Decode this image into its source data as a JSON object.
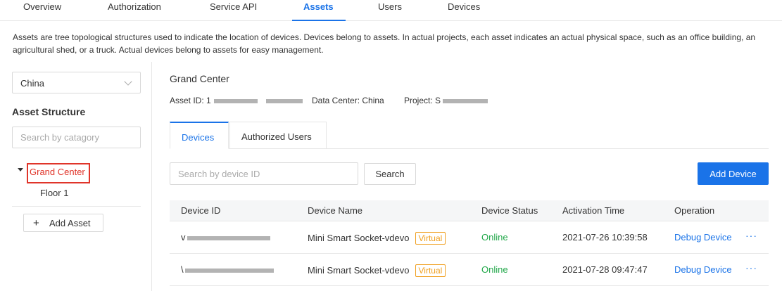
{
  "nav": {
    "tabs": [
      {
        "label": "Overview"
      },
      {
        "label": "Authorization"
      },
      {
        "label": "Service API"
      },
      {
        "label": "Assets"
      },
      {
        "label": "Users"
      },
      {
        "label": "Devices"
      }
    ],
    "active": "Assets"
  },
  "description": "Assets are tree topological structures used to indicate the location of devices. Devices belong to assets. In actual projects, each asset indicates an actual physical space, such as an office building, an agricultural shed, or a truck. Actual devices belong to assets for easy management.",
  "sidebar": {
    "region_select": "China",
    "structure_title": "Asset Structure",
    "search_placeholder": "Search by catagory",
    "tree": {
      "root": "Grand Center",
      "children": [
        "Floor 1"
      ]
    },
    "add_asset_label": "Add Asset"
  },
  "asset": {
    "title": "Grand Center",
    "id_label": "Asset ID: 1",
    "data_center_label": "Data Center: China",
    "project_label": "Project: S"
  },
  "content_tabs": {
    "devices": "Devices",
    "authorized_users": "Authorized Users"
  },
  "toolbar": {
    "search_placeholder": "Search by device ID",
    "search_label": "Search",
    "add_device_label": "Add Device"
  },
  "table": {
    "headers": [
      "Device ID",
      "Device Name",
      "Device Status",
      "Activation Time",
      "Operation"
    ],
    "rows": [
      {
        "id_prefix": "v",
        "name": "Mini Smart Socket-vdevo",
        "badge": "Virtual",
        "status": "Online",
        "activation": "2021-07-26 10:39:58",
        "operation": "Debug Device",
        "more": "···"
      },
      {
        "id_prefix": "\\",
        "name": "Mini Smart Socket-vdevo",
        "badge": "Virtual",
        "status": "Online",
        "activation": "2021-07-28 09:47:47",
        "operation": "Debug Device",
        "more": "···"
      }
    ]
  },
  "colors": {
    "accent": "#1a73e8",
    "highlight": "#e0352a",
    "online": "#22a84a",
    "virtual_badge": "#f0a020"
  }
}
